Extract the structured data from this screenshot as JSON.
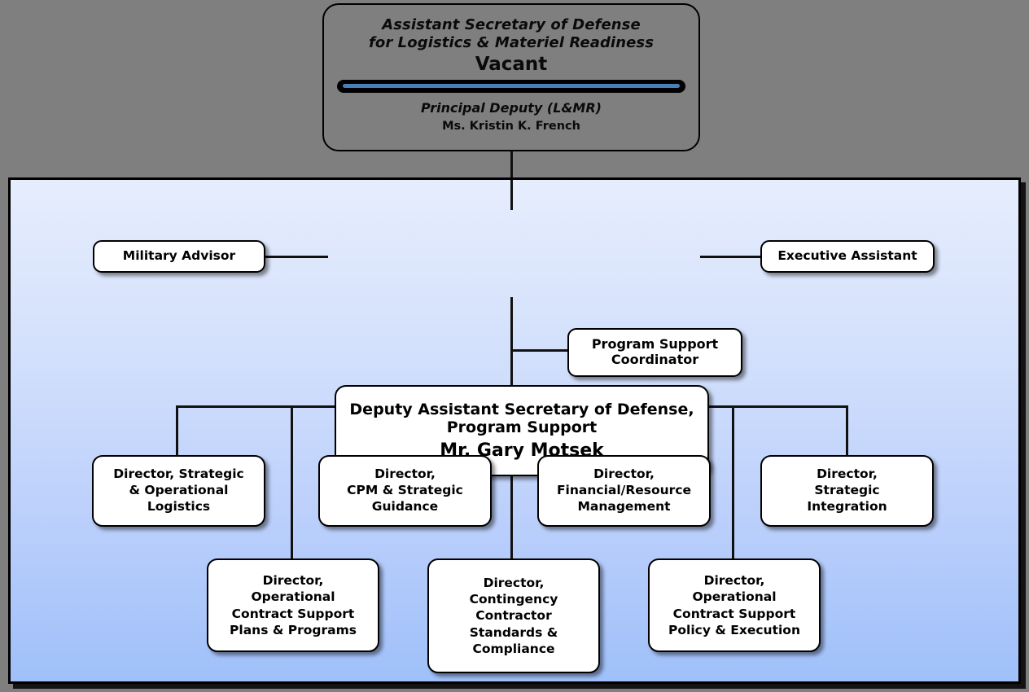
{
  "chart_type": "organization-chart",
  "colors": {
    "background": "#7f7f7f",
    "panel_top": "#e6edfd",
    "panel_bottom": "#9fc0fa",
    "node_fill": "#ffffff",
    "line": "#111111",
    "divider_accent": "#4a7ebb"
  },
  "top": {
    "title_line1": "Assistant Secretary of Defense",
    "title_line2": "for Logistics & Materiel Readiness",
    "status": "Vacant",
    "deputy_title": "Principal Deputy (L&MR)",
    "deputy_name": "Ms.  Kristin K. French"
  },
  "main": {
    "title_line1": "Deputy Assistant Secretary of Defense,",
    "title_line2": "Program Support",
    "name": "Mr. Gary Motsek"
  },
  "staff": {
    "military_advisor": "Military Advisor",
    "executive_assistant": "Executive Assistant",
    "program_support_coordinator": "Program Support\nCoordinator"
  },
  "directors_row1": [
    {
      "label": "Director, Strategic\n& Operational\nLogistics"
    },
    {
      "label": "Director,\nCPM & Strategic\nGuidance"
    },
    {
      "label": "Director,\nFinancial/Resource\nManagement"
    },
    {
      "label": "Director,\nStrategic\nIntegration"
    }
  ],
  "directors_row2": [
    {
      "label": "Director,\nOperational\nContract Support\nPlans & Programs"
    },
    {
      "label": "Director,\nContingency\nContractor\nStandards &\nCompliance"
    },
    {
      "label": "Director,\nOperational\nContract Support\nPolicy & Execution"
    }
  ]
}
